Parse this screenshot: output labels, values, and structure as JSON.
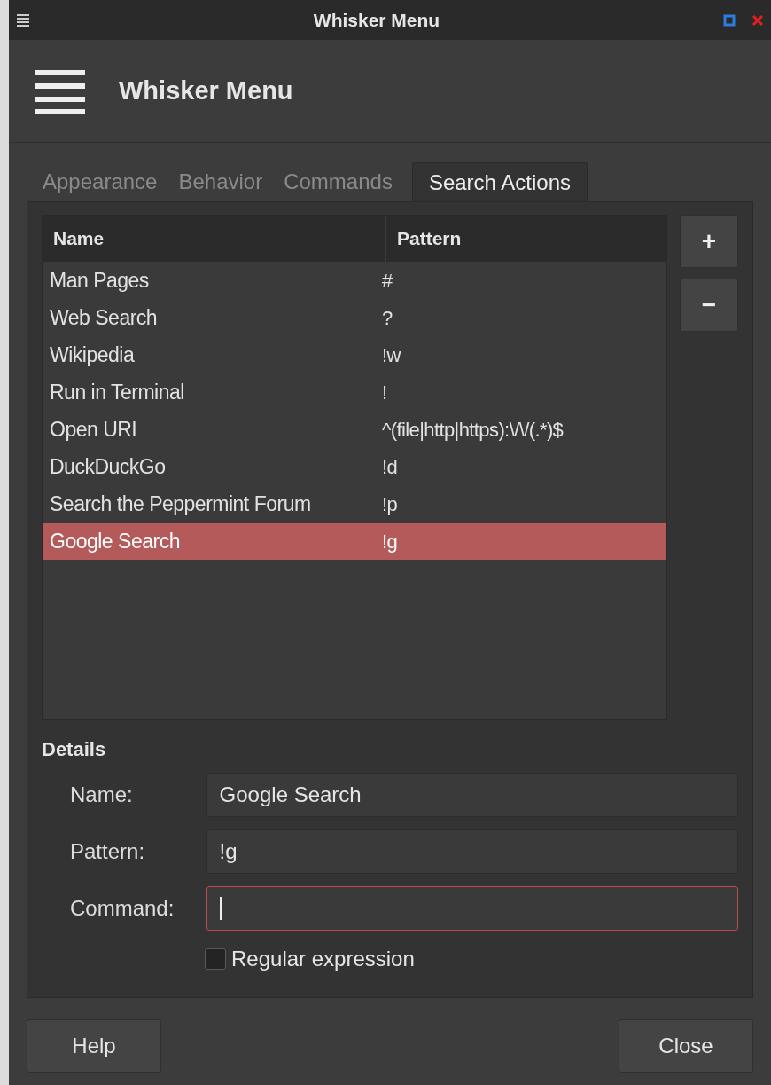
{
  "window": {
    "title": "Whisker Menu"
  },
  "header": {
    "title": "Whisker Menu"
  },
  "tabs": [
    {
      "label": "Appearance",
      "selected": false
    },
    {
      "label": "Behavior",
      "selected": false
    },
    {
      "label": "Commands",
      "selected": false
    },
    {
      "label": "Search Actions",
      "selected": true
    }
  ],
  "table": {
    "columns": [
      "Name",
      "Pattern"
    ],
    "rows": [
      {
        "name": "Man Pages",
        "pattern": "#",
        "selected": false
      },
      {
        "name": "Web Search",
        "pattern": "?",
        "selected": false
      },
      {
        "name": "Wikipedia",
        "pattern": "!w",
        "selected": false
      },
      {
        "name": "Run in Terminal",
        "pattern": "!",
        "selected": false
      },
      {
        "name": "Open URI",
        "pattern": "^(file|http|https):\\/\\/(.*)$",
        "selected": false
      },
      {
        "name": "DuckDuckGo",
        "pattern": "!d",
        "selected": false
      },
      {
        "name": "Search the Peppermint Forum",
        "pattern": "!p",
        "selected": false
      },
      {
        "name": "Google Search",
        "pattern": "!g",
        "selected": true
      }
    ]
  },
  "side_buttons": [
    "+",
    "−"
  ],
  "details": {
    "title": "Details",
    "fields": [
      {
        "label": "Name:",
        "value": "Google Search",
        "focused": false
      },
      {
        "label": "Pattern:",
        "value": "!g",
        "focused": false
      },
      {
        "label": "Command:",
        "focused": true
      }
    ],
    "regex": {
      "label": "Regular expression",
      "checked": false
    }
  },
  "buttons": {
    "help": "Help",
    "close": "Close"
  }
}
